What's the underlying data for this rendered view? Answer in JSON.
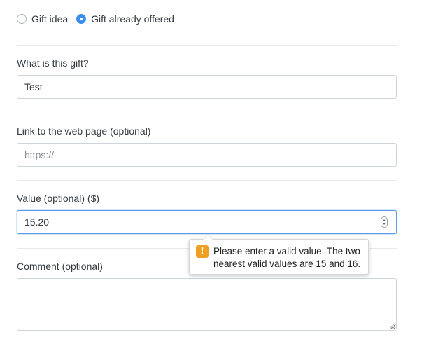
{
  "gift_type": {
    "options": [
      {
        "label": "Gift idea",
        "checked": false
      },
      {
        "label": "Gift already offered",
        "checked": true
      }
    ]
  },
  "fields": {
    "what": {
      "label": "What is this gift?",
      "value": "Test"
    },
    "link": {
      "label": "Link to the web page (optional)",
      "value": "",
      "placeholder": "https://"
    },
    "value": {
      "label": "Value (optional) ($)",
      "value": "15.20"
    },
    "comment": {
      "label": "Comment (optional)",
      "value": ""
    }
  },
  "validation_tooltip": {
    "icon": "warning-icon",
    "icon_glyph": "!",
    "message": "Please enter a valid value. The two nearest valid values are 15 and 16.",
    "accent_color": "#f0a020"
  },
  "colors": {
    "radio_checked": "#3b8ef0",
    "focus_border": "#5a9be8"
  }
}
